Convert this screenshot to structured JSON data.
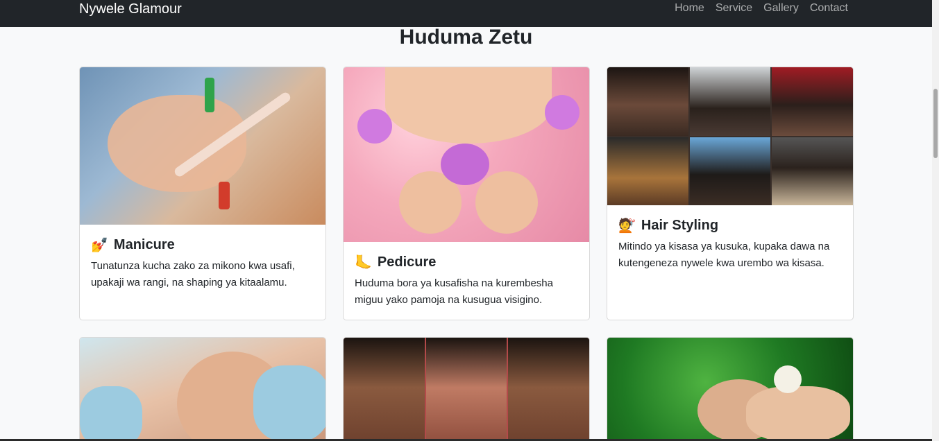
{
  "navbar": {
    "brand": "Nywele Glamour",
    "links": [
      "Home",
      "Service",
      "Gallery",
      "Contact"
    ]
  },
  "section": {
    "title": "Huduma Zetu"
  },
  "cards": [
    {
      "emoji": "💅",
      "title": "Manicure",
      "text": "Tunatunza kucha zako za mikono kwa usafi, upakaji wa rangi, na shaping ya kitaalamu.",
      "image_icon": "manicure-photo"
    },
    {
      "emoji": "🦶",
      "title": "Pedicure",
      "text": "Huduma bora ya kusafisha na kurembesha miguu yako pamoja na kusugua visigino.",
      "image_icon": "pedicure-photo"
    },
    {
      "emoji": "💇",
      "title": "Hair Styling",
      "text": "Mitindo ya kisasa ya kusuka, kupaka dawa na kutengeneza nywele kwa urembo wa kisasa.",
      "image_icon": "hair-styling-photo"
    }
  ],
  "colors": {
    "navbar_bg": "#212529",
    "page_bg": "#f8f9fa",
    "card_bg": "#ffffff"
  }
}
